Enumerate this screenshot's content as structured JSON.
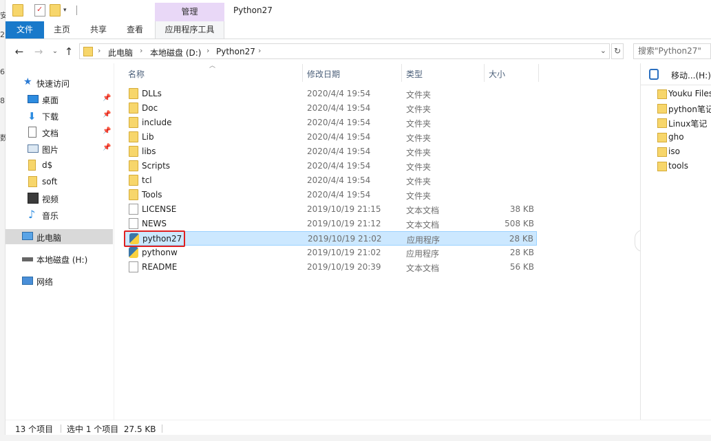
{
  "window": {
    "title": "Python27",
    "manage_tab": "管理"
  },
  "ribbon": {
    "tabs": [
      "文件",
      "主页",
      "共享",
      "查看"
    ],
    "tool_tab": "应用程序工具"
  },
  "address": {
    "crumbs": [
      "此电脑",
      "本地磁盘 (D:)",
      "Python27"
    ],
    "search_placeholder": "搜索\"Python27\""
  },
  "nav": {
    "quick_access": "快速访问",
    "items": [
      {
        "label": "桌面",
        "icon": "desktop-icon",
        "pinned": true
      },
      {
        "label": "下载",
        "icon": "download-icon",
        "pinned": true
      },
      {
        "label": "文档",
        "icon": "document-icon",
        "pinned": true
      },
      {
        "label": "图片",
        "icon": "picture-icon",
        "pinned": true
      },
      {
        "label": "d$",
        "icon": "shared-folder-icon",
        "pinned": false
      },
      {
        "label": "soft",
        "icon": "folder-icon",
        "pinned": false
      },
      {
        "label": "视频",
        "icon": "video-icon",
        "pinned": false
      },
      {
        "label": "音乐",
        "icon": "music-icon",
        "pinned": false
      }
    ],
    "this_pc": "此电脑",
    "drive_h": "本地磁盘 (H:)",
    "network": "网络"
  },
  "columns": {
    "name": "名称",
    "date": "修改日期",
    "type": "类型",
    "size": "大小"
  },
  "files": [
    {
      "name": "DLLs",
      "date": "2020/4/4 19:54",
      "type": "文件夹",
      "size": "",
      "kind": "folder"
    },
    {
      "name": "Doc",
      "date": "2020/4/4 19:54",
      "type": "文件夹",
      "size": "",
      "kind": "folder"
    },
    {
      "name": "include",
      "date": "2020/4/4 19:54",
      "type": "文件夹",
      "size": "",
      "kind": "folder"
    },
    {
      "name": "Lib",
      "date": "2020/4/4 19:54",
      "type": "文件夹",
      "size": "",
      "kind": "folder"
    },
    {
      "name": "libs",
      "date": "2020/4/4 19:54",
      "type": "文件夹",
      "size": "",
      "kind": "folder"
    },
    {
      "name": "Scripts",
      "date": "2020/4/4 19:54",
      "type": "文件夹",
      "size": "",
      "kind": "folder"
    },
    {
      "name": "tcl",
      "date": "2020/4/4 19:54",
      "type": "文件夹",
      "size": "",
      "kind": "folder"
    },
    {
      "name": "Tools",
      "date": "2020/4/4 19:54",
      "type": "文件夹",
      "size": "",
      "kind": "folder"
    },
    {
      "name": "LICENSE",
      "date": "2019/10/19 21:15",
      "type": "文本文档",
      "size": "38 KB",
      "kind": "doc"
    },
    {
      "name": "NEWS",
      "date": "2019/10/19 21:12",
      "type": "文本文档",
      "size": "508 KB",
      "kind": "doc"
    },
    {
      "name": "python27",
      "date": "2019/10/19 21:02",
      "type": "应用程序",
      "size": "28 KB",
      "kind": "py",
      "selected": true
    },
    {
      "name": "pythonw",
      "date": "2019/10/19 21:02",
      "type": "应用程序",
      "size": "28 KB",
      "kind": "py"
    },
    {
      "name": "README",
      "date": "2019/10/19 20:39",
      "type": "文本文档",
      "size": "56 KB",
      "kind": "doc"
    }
  ],
  "right_pane": {
    "header": "移动...(H:)",
    "items": [
      "Youku Files",
      "python笔记",
      "Linux笔记",
      "gho",
      "iso",
      "tools"
    ]
  },
  "status": {
    "count": "13 个项目",
    "selection": "选中 1 个项目  27.5 KB"
  }
}
